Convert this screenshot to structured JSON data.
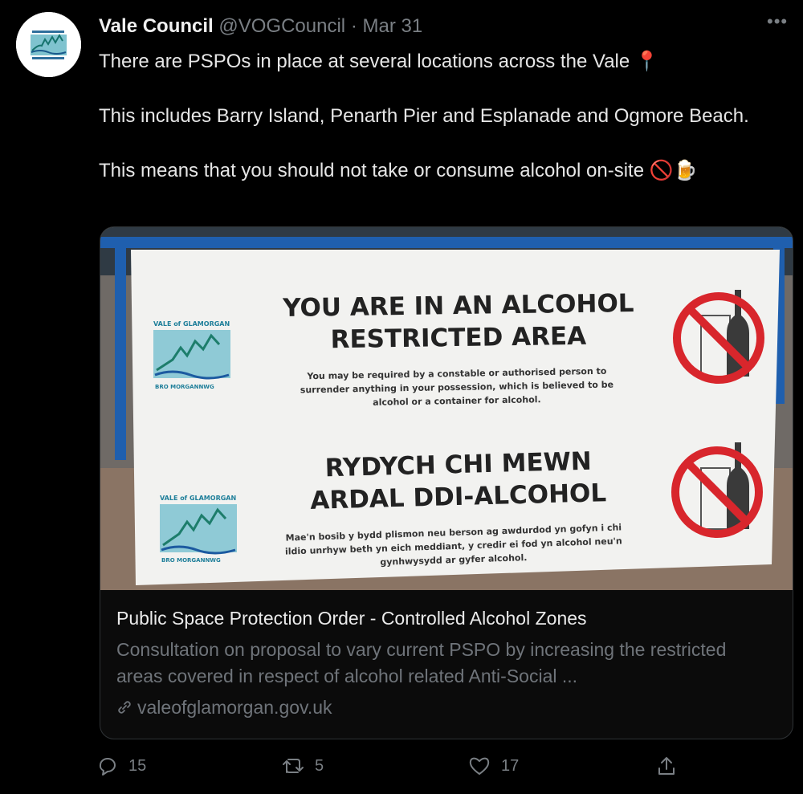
{
  "tweet": {
    "author_name": "Vale Council",
    "author_handle": "@VOGCouncil",
    "separator": "·",
    "date": "Mar 31",
    "more_label": "•••",
    "text_line1": "There are PSPOs in place at several locations across the Vale 📍",
    "text_line2": "This includes Barry Island, Penarth Pier and Esplanade and Ogmore Beach.",
    "text_line3": "This means that you should not take or consume alcohol on-site 🚫🍺"
  },
  "banner": {
    "english_heading_1": "YOU ARE IN AN ALCOHOL",
    "english_heading_2": "RESTRICTED AREA",
    "english_body_1": "You may be required by a constable or authorised person to",
    "english_body_2": "surrender anything in your possession, which is believed to be",
    "english_body_3": "alcohol or a container for alcohol.",
    "welsh_heading_1": "RYDYCH CHI MEWN",
    "welsh_heading_2": "ARDAL DDI-ALCOHOL",
    "welsh_body_1": "Mae'n bosib y bydd plismon neu berson ag awdurdod yn gofyn i chi",
    "welsh_body_2": "ildio unrhyw beth yn eich meddiant, y credir ei fod yn alcohol neu'n",
    "welsh_body_3": "gynhwysydd ar gyfer alcohol.",
    "logo_top_text": "VALE of GLAMORGAN",
    "logo_bottom_text": "BRO MORGANNWG"
  },
  "card": {
    "title": "Public Space Protection Order - Controlled Alcohol Zones",
    "description": "Consultation on proposal to vary current PSPO by increasing the restricted areas covered in respect of alcohol related Anti-Social ...",
    "link": "valeofglamorgan.gov.uk"
  },
  "actions": {
    "reply_count": "15",
    "retweet_count": "5",
    "like_count": "17"
  },
  "colors": {
    "background": "#000000",
    "secondary_text": "#7a7f84",
    "prohibition_red": "#d8262c"
  }
}
